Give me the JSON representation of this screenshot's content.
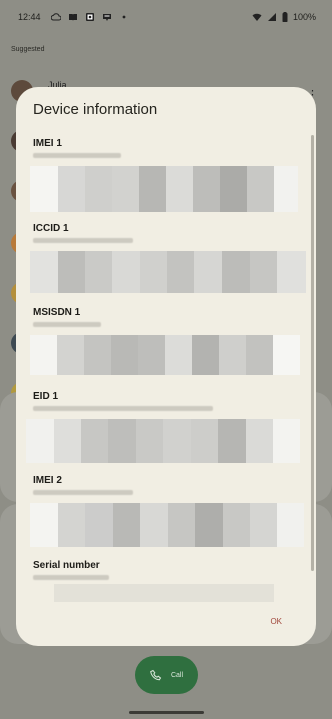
{
  "status_bar": {
    "time": "12:44",
    "notification_icons": [
      "cloud-icon",
      "book-icon",
      "photo-icon",
      "news-icon",
      "dot-icon"
    ],
    "battery": "100%"
  },
  "background": {
    "section_label": "Suggested",
    "contact_name": "Julia"
  },
  "dialog": {
    "title": "Device information",
    "fields": [
      {
        "label": "IMEI 1"
      },
      {
        "label": "ICCID 1"
      },
      {
        "label": "MSISDN 1"
      },
      {
        "label": "EID 1"
      },
      {
        "label": "IMEI 2"
      },
      {
        "label": "Serial number"
      }
    ],
    "ok_label": "OK"
  },
  "call_button": {
    "label": "Call"
  },
  "colors": {
    "dialog_bg": "#f1eee3",
    "scrim": "#8e8e86",
    "ok_text": "#a0463b",
    "call_button": "#2f6f3f"
  }
}
